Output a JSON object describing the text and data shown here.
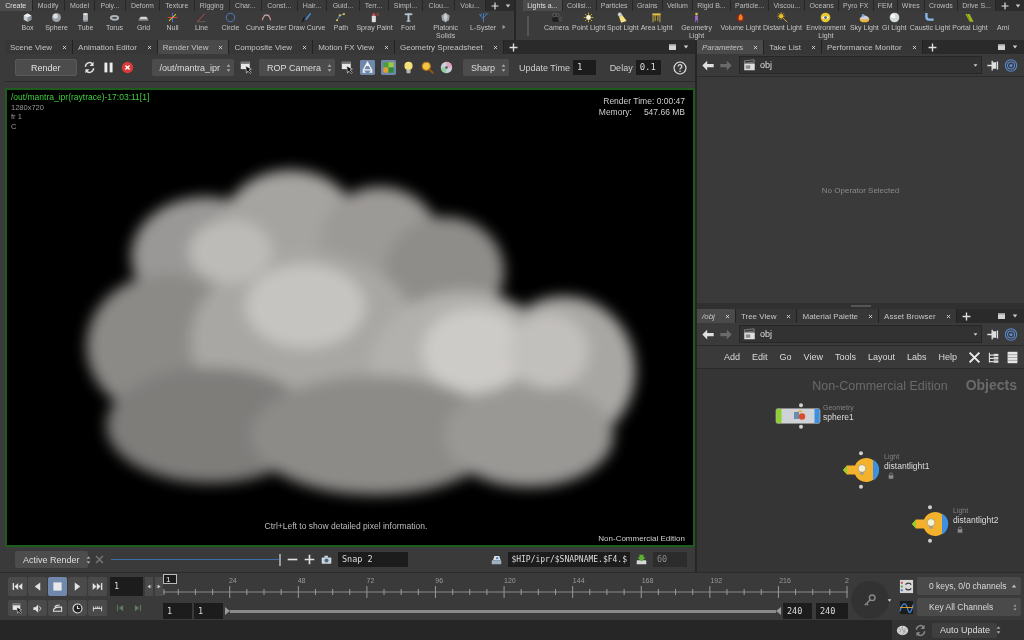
{
  "shelf_left": {
    "tabs": [
      {
        "label": "Create",
        "selected": true
      },
      {
        "label": "Modify",
        "selected": false
      },
      {
        "label": "Model",
        "selected": false
      },
      {
        "label": "Poly...",
        "selected": false
      },
      {
        "label": "Deform",
        "selected": false
      },
      {
        "label": "Texture",
        "selected": false
      },
      {
        "label": "Rigging",
        "selected": false
      },
      {
        "label": "Char...",
        "selected": false
      },
      {
        "label": "Const...",
        "selected": false
      },
      {
        "label": "Hair...",
        "selected": false
      },
      {
        "label": "Guid...",
        "selected": false
      },
      {
        "label": "Terr...",
        "selected": false
      },
      {
        "label": "Simpl...",
        "selected": false
      },
      {
        "label": "Clou...",
        "selected": false
      },
      {
        "label": "Volu...",
        "selected": false
      }
    ],
    "tools": [
      {
        "label": "Box"
      },
      {
        "label": "Sphere"
      },
      {
        "label": "Tube"
      },
      {
        "label": "Torus"
      },
      {
        "label": "Grid"
      },
      {
        "label": "Null"
      },
      {
        "label": "Line"
      },
      {
        "label": "Circle"
      },
      {
        "label": "Curve Bezier"
      },
      {
        "label": "Draw Curve"
      },
      {
        "label": "Path"
      },
      {
        "label": "Spray Paint"
      },
      {
        "label": "Font"
      },
      {
        "label": "Platonic Solids"
      },
      {
        "label": "L-Syster"
      }
    ]
  },
  "shelf_right": {
    "tabs": [
      {
        "label": "Lights a...",
        "selected": true
      },
      {
        "label": "Collisi...",
        "selected": false
      },
      {
        "label": "Particles",
        "selected": false
      },
      {
        "label": "Grains",
        "selected": false
      },
      {
        "label": "Vellum",
        "selected": false
      },
      {
        "label": "Rigid B...",
        "selected": false
      },
      {
        "label": "Particle...",
        "selected": false
      },
      {
        "label": "Viscou...",
        "selected": false
      },
      {
        "label": "Oceans",
        "selected": false
      },
      {
        "label": "Pyro FX",
        "selected": false
      },
      {
        "label": "FEM",
        "selected": false
      },
      {
        "label": "Wires",
        "selected": false
      },
      {
        "label": "Crowds",
        "selected": false
      },
      {
        "label": "Drive S...",
        "selected": false
      }
    ],
    "tools": [
      {
        "label": "Camera"
      },
      {
        "label": "Point Light"
      },
      {
        "label": "Spot Light"
      },
      {
        "label": "Area Light"
      },
      {
        "label": "Geometry Light"
      },
      {
        "label": "Volume Light"
      },
      {
        "label": "Distant Light"
      },
      {
        "label": "Environment Light"
      },
      {
        "label": "Sky Light"
      },
      {
        "label": "GI Light"
      },
      {
        "label": "Caustic Light"
      },
      {
        "label": "Portal Light"
      },
      {
        "label": "Ami"
      }
    ]
  },
  "render_view": {
    "tabs": [
      {
        "label": "Scene View",
        "selected": false
      },
      {
        "label": "Animation Editor",
        "selected": false
      },
      {
        "label": "Render View",
        "selected": true
      },
      {
        "label": "Composite View",
        "selected": false
      },
      {
        "label": "Motion FX View",
        "selected": false
      },
      {
        "label": "Geometry Spreadsheet",
        "selected": false
      }
    ],
    "toolbar": {
      "render_button": "Render",
      "rop": "/out/mantra_ipr",
      "camera": "ROP Camera",
      "preview_on": true,
      "tiles_on": true,
      "sharpness": "Sharp",
      "update_time_label": "Update Time",
      "update_time": "1",
      "delay_label": "Delay",
      "delay": "0.1"
    },
    "overlay": {
      "title": "/out/mantra_ipr(raytrace)-17:03:11[1]",
      "resolution": "1280x720",
      "frame": "fr 1",
      "channel": "C",
      "render_time": "Render Time: 0:00:47",
      "memory_label": "Memory:",
      "memory": "547.66 MB",
      "hint": "Ctrl+Left to show detailed pixel information.",
      "edition": "Non-Commercial Edition"
    },
    "snapshot_bar": {
      "mode": "Active Render",
      "level": 1,
      "snapshot": "Snap 2",
      "path": "$HIP/ipr/$SNAPNAME.$F4.$",
      "limit": {
        "value": "60",
        "disabled": true
      }
    }
  },
  "parameters_pane": {
    "tabs": [
      {
        "label": "Parameters",
        "selected": true
      },
      {
        "label": "Take List",
        "selected": false
      },
      {
        "label": "Performance Monitor",
        "selected": false
      }
    ],
    "path": "obj",
    "message": "No Operator Selected"
  },
  "network_pane": {
    "tabs": [
      {
        "label": "/obj",
        "selected": true
      },
      {
        "label": "Tree View",
        "selected": false
      },
      {
        "label": "Material Palette",
        "selected": false
      },
      {
        "label": "Asset Browser",
        "selected": false
      }
    ],
    "path": "obj",
    "menu": [
      "Add",
      "Edit",
      "Go",
      "View",
      "Tools",
      "Layout",
      "Labs",
      "Help"
    ],
    "edition": "Non-Commercial Edition",
    "context": "Objects",
    "nodes": [
      {
        "kind": "geometry",
        "type": "Geometry",
        "name": "sphere1",
        "locked": false
      },
      {
        "kind": "light",
        "type": "Light",
        "name": "distantlight1",
        "locked": true
      },
      {
        "kind": "light",
        "type": "Light",
        "name": "distantlight2",
        "locked": true
      }
    ]
  },
  "timeline": {
    "playing": false,
    "frame": "1",
    "marker": "1",
    "ticks": [
      "24",
      "48",
      "72",
      "96",
      "120",
      "144",
      "168",
      "192",
      "216",
      "2"
    ],
    "start": "1",
    "start_visible": "1",
    "range_bar": {
      "level": 1
    },
    "end": "240",
    "end_visible": "240",
    "keys": "0 keys, 0/0 channels",
    "key_mode": "Key All Channels"
  },
  "status_bar": {
    "update_mode": "Auto Update"
  }
}
